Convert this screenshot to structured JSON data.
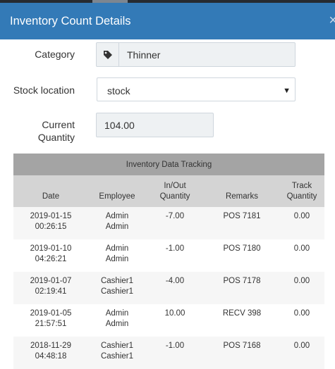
{
  "header": {
    "title": "Inventory Count Details",
    "close_label": "×"
  },
  "form": {
    "category": {
      "label": "Category",
      "value": "Thinner",
      "icon": "tag-icon"
    },
    "stock_location": {
      "label": "Stock location",
      "value": "stock",
      "caret": "▼"
    },
    "current_quantity": {
      "label_line1": "Current",
      "label_line2": "Quantity",
      "value": "104.00"
    }
  },
  "table": {
    "caption": "Inventory Data Tracking",
    "headers": {
      "date": "Date",
      "employee": "Employee",
      "inout_line1": "In/Out",
      "inout_line2": "Quantity",
      "remarks": "Remarks",
      "track_line1": "Track",
      "track_line2": "Quantity"
    },
    "rows": [
      {
        "date": "2019-01-15",
        "time": "00:26:15",
        "emp1": "Admin",
        "emp2": "Admin",
        "inout": "-7.00",
        "remarks": "POS 7181",
        "track": "0.00"
      },
      {
        "date": "2019-01-10",
        "time": "04:26:21",
        "emp1": "Admin",
        "emp2": "Admin",
        "inout": "-1.00",
        "remarks": "POS 7180",
        "track": "0.00"
      },
      {
        "date": "2019-01-07",
        "time": "02:19:41",
        "emp1": "Cashier1",
        "emp2": "Cashier1",
        "inout": "-4.00",
        "remarks": "POS 7178",
        "track": "0.00"
      },
      {
        "date": "2019-01-05",
        "time": "21:57:51",
        "emp1": "Admin",
        "emp2": "Admin",
        "inout": "10.00",
        "remarks": "RECV 398",
        "track": "0.00"
      },
      {
        "date": "2018-11-29",
        "time": "04:48:18",
        "emp1": "Cashier1",
        "emp2": "Cashier1",
        "inout": "-1.00",
        "remarks": "POS 7168",
        "track": "0.00"
      }
    ]
  },
  "colors": {
    "header": "#337ab7",
    "caption": "#a4a4a4",
    "column_header": "#d4d4d4",
    "row_alt": "#f6f6f6"
  }
}
